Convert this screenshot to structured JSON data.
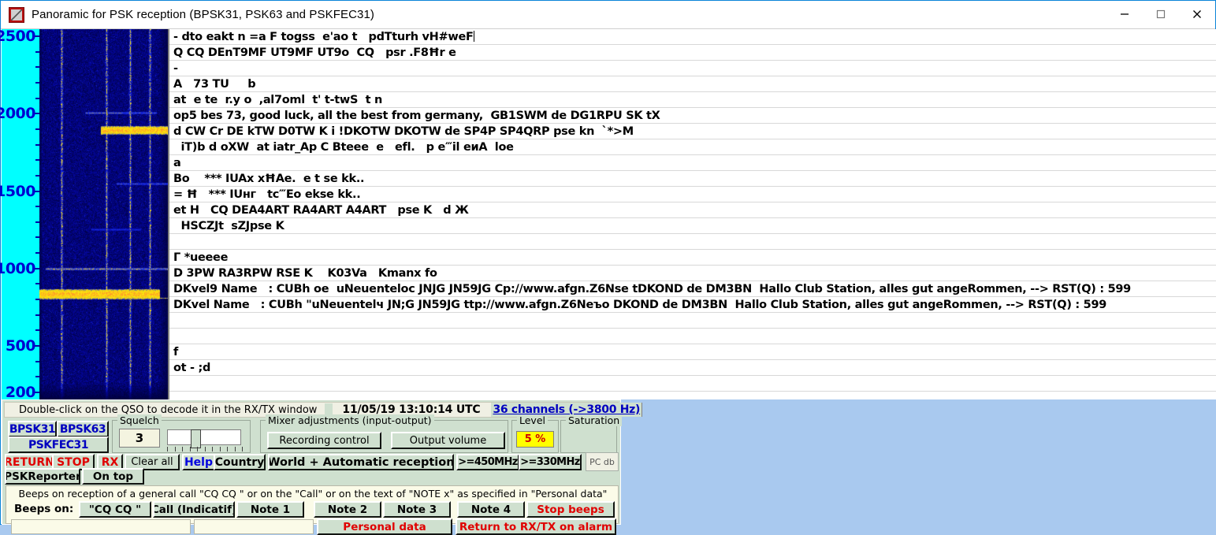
{
  "window": {
    "title": "Panoramic for PSK reception (BPSK31, PSK63 and PSKFEC31)",
    "minimize_label": "—",
    "maximize_label": "□",
    "close_label": "✕"
  },
  "scale": {
    "unit": "Hz",
    "major_labels": [
      "2500",
      "2000",
      "1500",
      "1000",
      "500",
      "200"
    ],
    "max": 2500,
    "min": 200
  },
  "qso": {
    "lines": [
      "- dto eakt n =a F togss  e'ao t   pdTturh vH#weF",
      "Q CQ DEnT9MF UT9MF UT9o  CQ   psr .F8Ħr e",
      "-",
      "A   73 TU     b",
      "at  e te  r.y o  ,al7oml  t' t-twS  t n",
      "op5 bes 73, good luck, all the best from germany,  GB1SWM de DG1RPU SK tX",
      "d CW Cr DE kTW D0TW K i !DKOTW DKOTW de SP4P SP4QRP pse kn  `*>M",
      "  iT)b d oXW  at iatr_Ap C Bteee  e   efl.   p e‴il eиA  loe",
      "a",
      "Bo    *** IUAx xĦAe.  e t se kk..",
      "= Ħ   *** IUнг   tc‴Eo ekse kk..",
      "et H   CQ DEA4ART RA4ART A4ART   pse K   d Ж",
      "  HSCZJt  sZJpse K",
      "",
      "Г *ueeee",
      "D 3PW RA3RPW RSE K    K03Va   Kmanx fo",
      "DKvel9 Name   : CUBh oe  uNeuenteloc JNJG JN59JG Cp://www.afgn.Z6Nse tDKOND de DM3BN  Hallo Club Station, alles gut angeRommen, --> RST(Q) : 599",
      "DKvel Name   : CUBh \"uNeuentelч JN;G JN59JG ttp://www.afgn.Z6Neъo DKOND de DM3BN  Hallo Club Station, alles gut angeRommen, --> RST(Q) : 599",
      "",
      "",
      "f",
      "ot - ;d",
      ""
    ],
    "cursor_line_index": 0
  },
  "status": {
    "hint": "Double-click on the QSO to decode it in the RX/TX window",
    "timestamp": "11/05/19 13:10:14 UTC",
    "channels": "36 channels (->3800 Hz)"
  },
  "modes": {
    "bpsk31": "BPSK31",
    "bpsk63": "BPSK63",
    "pskfec31": "PSKFEC31"
  },
  "squelch": {
    "title": "Squelch",
    "value": "3"
  },
  "mixer": {
    "title": "Mixer adjustments (input-output)",
    "recording_control": "Recording control",
    "output_volume": "Output volume"
  },
  "level": {
    "title": "Level",
    "value": "5 %"
  },
  "saturation": {
    "title": "Saturation"
  },
  "actions": {
    "return": "RETURN",
    "stop": "STOP",
    "rx": "RX",
    "clear_all": "Clear all",
    "help": "Help",
    "country": "Country",
    "world": "World + Automatic reception",
    "freq450": ">=450MHz",
    "freq330": ">=330MHz",
    "pc_db": "PC db",
    "pskreporter": "PSKReporter",
    "on_top": "On top"
  },
  "beeps": {
    "description": "Beeps on reception of a general call \"CQ CQ \" or on the \"Call\" or on the text of \"NOTE x\" as specified in \"Personal data\"",
    "label": "Beeps on:",
    "cq_cq": "\"CQ CQ \"",
    "call": "Call (Indicatif)",
    "note1": "Note 1",
    "note2": "Note 2",
    "note3": "Note 3",
    "note4": "Note 4",
    "stop_beeps": "Stop beeps",
    "field1": "",
    "field2": "",
    "personal_data": "Personal data",
    "return_alarm": "Return to RX/TX on alarm"
  },
  "colors": {
    "scale_bg": "#00ffff",
    "scale_text": "#0000d0",
    "panel_bg": "#cfe0cf",
    "desktop": "#a9c9ef",
    "accent_red": "#e00000",
    "accent_blue": "#0000c0",
    "level_bg": "#ffff00"
  }
}
